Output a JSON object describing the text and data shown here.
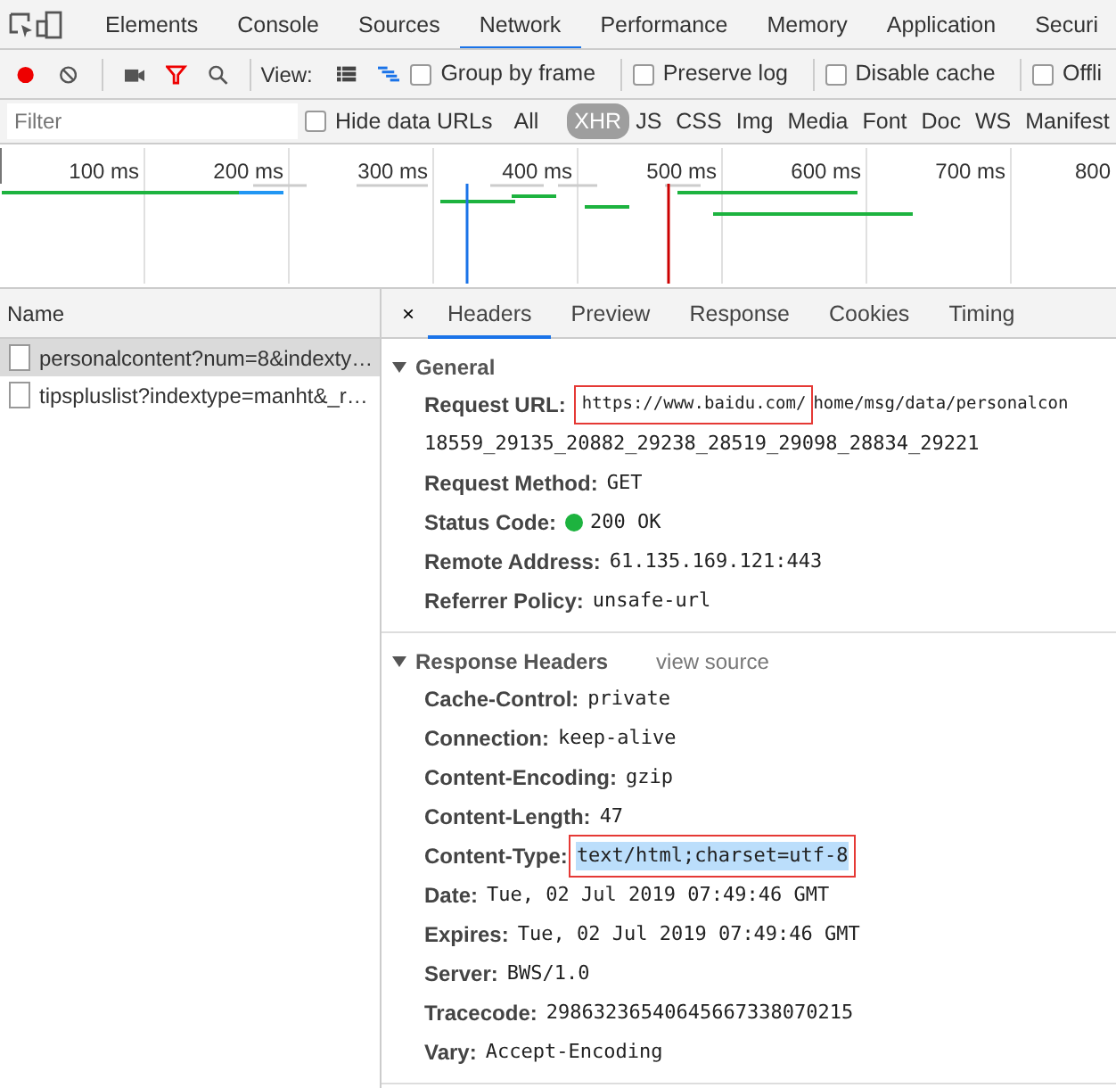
{
  "devtools_tabs": [
    {
      "label": "Elements",
      "selected": false
    },
    {
      "label": "Console",
      "selected": false
    },
    {
      "label": "Sources",
      "selected": false
    },
    {
      "label": "Network",
      "selected": true
    },
    {
      "label": "Performance",
      "selected": false
    },
    {
      "label": "Memory",
      "selected": false
    },
    {
      "label": "Application",
      "selected": false
    },
    {
      "label": "Securi",
      "selected": false
    }
  ],
  "toolbar": {
    "record_on": true,
    "filter_on": true,
    "view_label": "View:",
    "views": [
      {
        "kind": "list",
        "selected": false
      },
      {
        "kind": "waterfall",
        "selected": true
      }
    ],
    "options": [
      {
        "label": "Group by frame",
        "checked": false
      },
      {
        "label": "Preserve log",
        "checked": false
      },
      {
        "label": "Disable cache",
        "checked": false
      },
      {
        "label": "Offli",
        "checked": false
      }
    ]
  },
  "filter_bar": {
    "placeholder": "Filter",
    "hide_data_urls": {
      "label": "Hide data URLs",
      "checked": false
    },
    "types": [
      {
        "label": "All",
        "selected": false
      },
      {
        "label": "XHR",
        "selected": true
      },
      {
        "label": "JS",
        "selected": false
      },
      {
        "label": "CSS",
        "selected": false
      },
      {
        "label": "Img",
        "selected": false
      },
      {
        "label": "Media",
        "selected": false
      },
      {
        "label": "Font",
        "selected": false
      },
      {
        "label": "Doc",
        "selected": false
      },
      {
        "label": "WS",
        "selected": false
      },
      {
        "label": "Manifest",
        "selected": false
      }
    ]
  },
  "overview": {
    "ticks": [
      "100 ms",
      "200 ms",
      "300 ms",
      "400 ms",
      "500 ms",
      "600 ms",
      "700 ms",
      "800"
    ]
  },
  "requests": {
    "column": "Name",
    "rows": [
      {
        "name": "personalcontent?num=8&indexty…",
        "selected": true
      },
      {
        "name": "tipspluslist?indextype=manht&_r…",
        "selected": false
      }
    ]
  },
  "detail": {
    "close": "×",
    "tabs": [
      {
        "label": "Headers",
        "selected": true
      },
      {
        "label": "Preview",
        "selected": false
      },
      {
        "label": "Response",
        "selected": false
      },
      {
        "label": "Cookies",
        "selected": false
      },
      {
        "label": "Timing",
        "selected": false
      }
    ],
    "general": {
      "title": "General",
      "expanded": true,
      "request_url": {
        "label": "Request URL:",
        "boxed_part": "https://www.baidu.com/",
        "rest": "home/msg/data/personalcon",
        "continuation": "18559_29135_20882_29238_28519_29098_28834_29221"
      },
      "fields": [
        {
          "label": "Request Method:",
          "value": "GET"
        },
        {
          "label": "Status Code:",
          "value": "200 OK",
          "color": "#1db33f"
        },
        {
          "label": "Remote Address:",
          "value": "61.135.169.121:443"
        },
        {
          "label": "Referrer Policy:",
          "value": "unsafe-url"
        }
      ]
    },
    "response_headers": {
      "title": "Response Headers",
      "expanded": true,
      "link": "view source",
      "fields": [
        {
          "label": "Cache-Control:",
          "value": "private",
          "boxed": false,
          "selected": false
        },
        {
          "label": "Connection:",
          "value": "keep-alive",
          "boxed": false,
          "selected": false
        },
        {
          "label": "Content-Encoding:",
          "value": "gzip",
          "boxed": false,
          "selected": false
        },
        {
          "label": "Content-Length:",
          "value": "47",
          "boxed": false,
          "selected": false
        },
        {
          "label": "Content-Type:",
          "value": "text/html;charset=utf-8",
          "boxed": true,
          "selected": true
        },
        {
          "label": "Date:",
          "value": "Tue, 02 Jul 2019 07:49:46 GMT",
          "boxed": false,
          "selected": false
        },
        {
          "label": "Expires:",
          "value": "Tue, 02 Jul 2019 07:49:46 GMT",
          "boxed": false,
          "selected": false
        },
        {
          "label": "Server:",
          "value": "BWS/1.0",
          "boxed": false,
          "selected": false
        },
        {
          "label": "Tracecode:",
          "value": "29863236540645667338070215",
          "boxed": false,
          "selected": false
        },
        {
          "label": "Vary:",
          "value": "Accept-Encoding",
          "boxed": false,
          "selected": false
        }
      ]
    }
  }
}
